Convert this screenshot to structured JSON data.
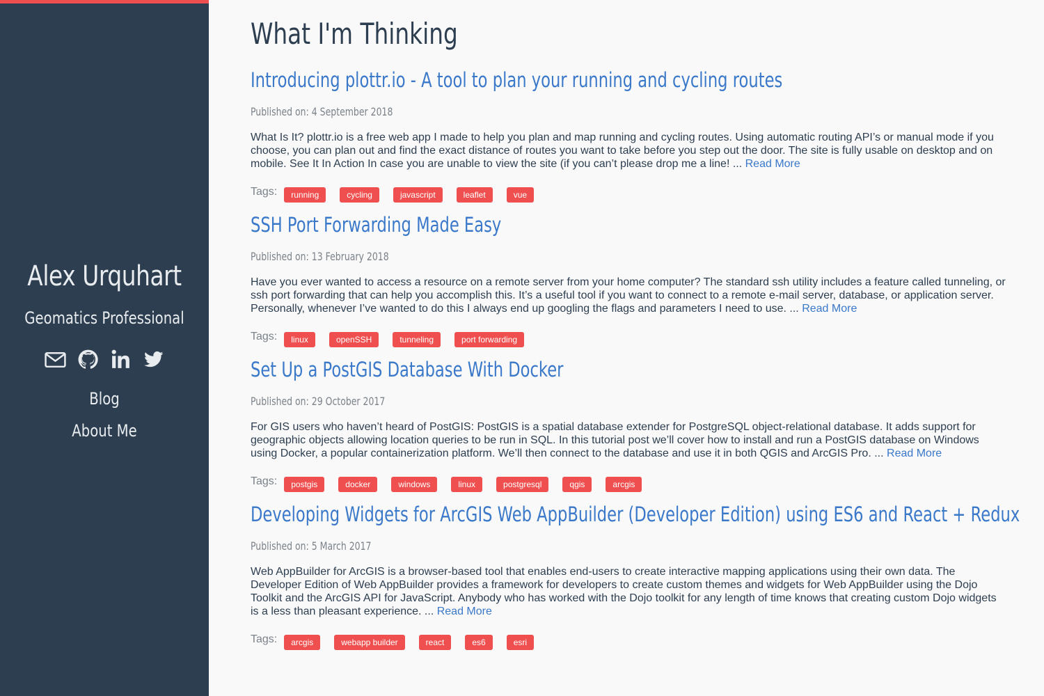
{
  "sidebar": {
    "name": "Alex Urquhart",
    "subtitle": "Geomatics Professional",
    "icons": [
      "mail-icon",
      "github-icon",
      "linkedin-icon",
      "twitter-icon"
    ],
    "nav": [
      {
        "label": "Blog"
      },
      {
        "label": "About Me"
      }
    ],
    "colors": {
      "background": "#2d3e50",
      "accent": "#ef4f4f"
    }
  },
  "main": {
    "title": "What I'm Thinking",
    "read_more": "Read More",
    "date_prefix": "Published on:",
    "tags_label": "Tags:",
    "posts": [
      {
        "title": "Introducing plottr.io - A tool to plan your running and cycling routes",
        "date": "4 September 2018",
        "excerpt": "What Is It? plottr.io is a free web app I made to help you plan and map running and cycling routes. Using automatic routing API’s or manual mode if you choose, you can plan out and find the exact distance of routes you want to take before you step out the door. The site is fully usable on desktop and on mobile. See It In Action In case you are unable to view the site (if you can’t please drop me a line! ...",
        "tags": [
          "running",
          "cycling",
          "javascript",
          "leaflet",
          "vue"
        ]
      },
      {
        "title": "SSH Port Forwarding Made Easy",
        "date": "13 February 2018",
        "excerpt": "Have you ever wanted to access a resource on a remote server from your home computer? The standard ssh utility includes a feature called tunneling, or ssh port forwarding that can help you accomplish this. It’s a useful tool if you want to connect to a remote e-mail server, database, or application server. Personally, whenever I’ve wanted to do this I always end up googling the flags and parameters I need to use. ...",
        "tags": [
          "linux",
          "openSSH",
          "tunneling",
          "port forwarding"
        ]
      },
      {
        "title": "Set Up a PostGIS Database With Docker",
        "date": "29 October 2017",
        "excerpt": "For GIS users who haven’t heard of PostGIS: PostGIS is a spatial database extender for PostgreSQL object-relational database. It adds support for geographic objects allowing location queries to be run in SQL. In this tutorial post we’ll cover how to install and run a PostGIS database on Windows using Docker, a popular containerization platform. We’ll then connect to the database and use it in both QGIS and ArcGIS Pro. ...",
        "tags": [
          "postgis",
          "docker",
          "windows",
          "linux",
          "postgresql",
          "qgis",
          "arcgis"
        ]
      },
      {
        "title": "Developing Widgets for ArcGIS Web AppBuilder (Developer Edition) using ES6 and React + Redux",
        "date": "5 March 2017",
        "excerpt": "Web AppBuilder for ArcGIS is a browser-based tool that enables end-users to create interactive mapping applications using their own data. The Developer Edition of Web AppBuilder provides a framework for developers to create custom themes and widgets for Web AppBuilder using the Dojo Toolkit and the ArcGIS API for JavaScript. Anybody who has worked with the Dojo toolkit for any length of time knows that creating custom Dojo widgets is a less than pleasant experience. ...",
        "tags": [
          "arcgis",
          "webapp builder",
          "react",
          "es6",
          "esri"
        ]
      }
    ],
    "colors": {
      "link": "#3a78c9",
      "tag": "#ef4f4f",
      "text": "#2d3e50"
    }
  }
}
